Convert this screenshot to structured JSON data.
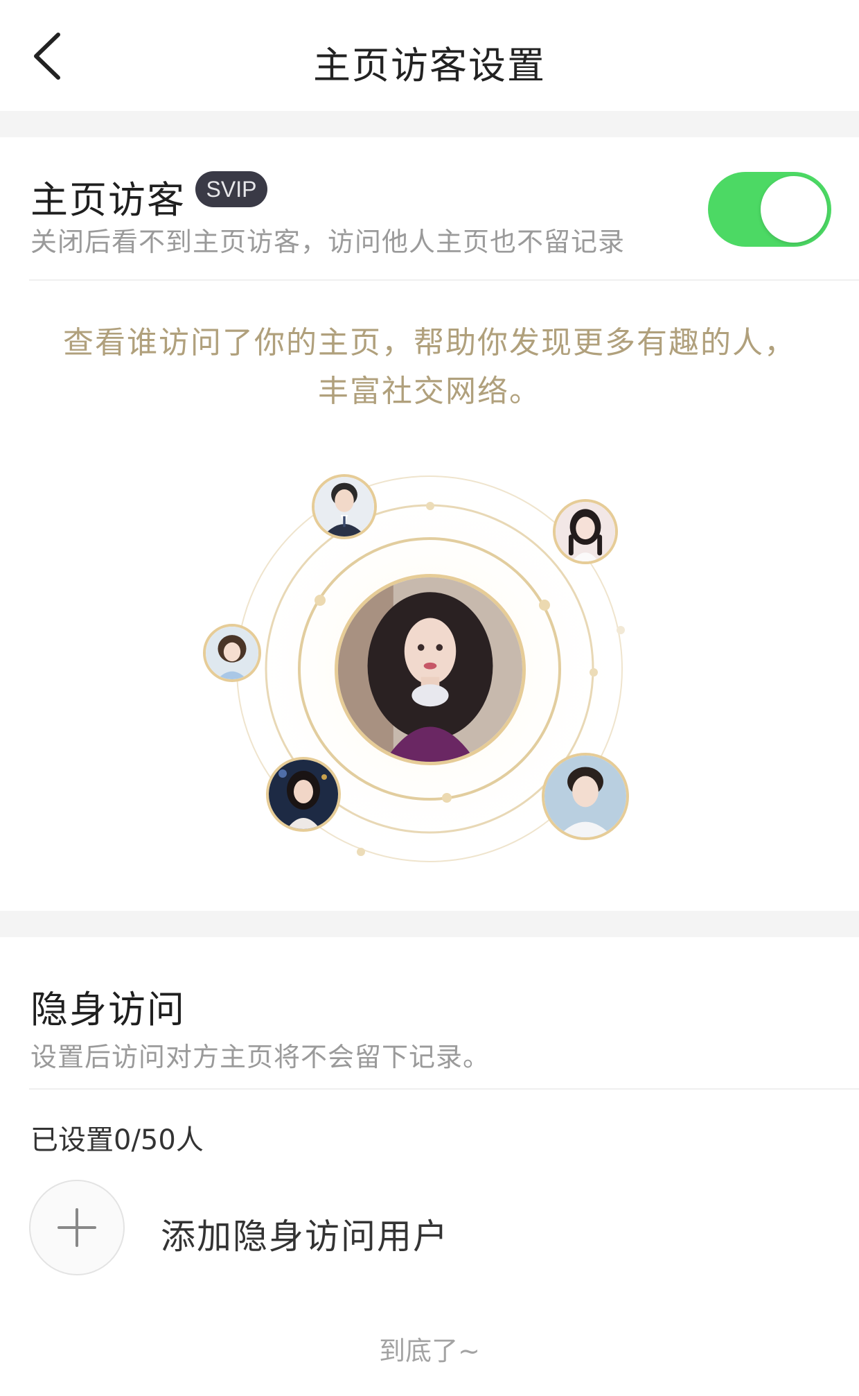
{
  "header": {
    "title": "主页访客设置",
    "back_icon": "chevron-left-icon"
  },
  "visitor_setting": {
    "title": "主页访客",
    "badge": "SVIP",
    "description": "关闭后看不到主页访客，访问他人主页也不留记录",
    "toggle_on": true,
    "toggle_color": "#4cd964"
  },
  "promo": {
    "line1": "查看谁访问了你的主页，帮助你发现更多有趣的人，",
    "line2": "丰富社交网络。",
    "color": "#b0a07c"
  },
  "stealth": {
    "title": "隐身访问",
    "description": "设置后访问对方主页将不会留下记录。",
    "count_text": "已设置0/50人",
    "add_label": "添加隐身访问用户",
    "add_icon": "plus-icon"
  },
  "footer": {
    "end_text": "到底了~"
  }
}
